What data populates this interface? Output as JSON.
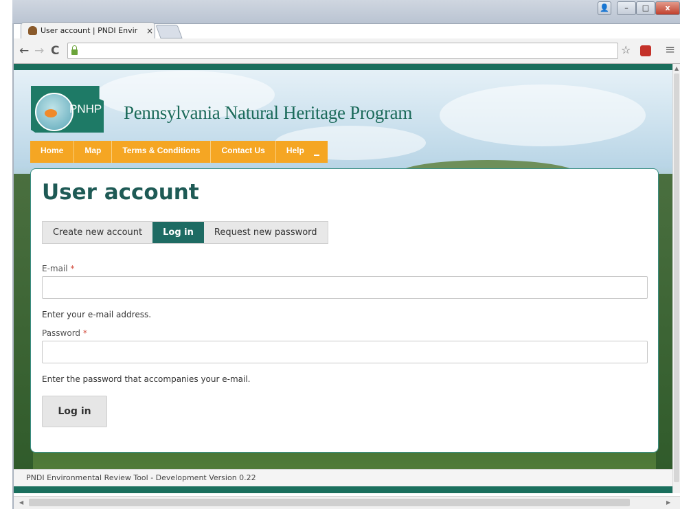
{
  "browser": {
    "tab_title": "User account | PNDI Envir",
    "tab_close": "×",
    "window_buttons": {
      "minimize": "–",
      "maximize": "□",
      "close": "x"
    }
  },
  "site": {
    "logo_text": "PNHP",
    "name": "Pennsylvania Natural Heritage Program",
    "nav": [
      {
        "label": "Home"
      },
      {
        "label": "Map"
      },
      {
        "label": "Terms & Conditions"
      },
      {
        "label": "Contact Us"
      },
      {
        "label": "Help"
      }
    ]
  },
  "page": {
    "title": "User account",
    "tabs": [
      {
        "label": "Create new account",
        "active": false
      },
      {
        "label": "Log in",
        "active": true
      },
      {
        "label": "Request new password",
        "active": false
      }
    ],
    "email": {
      "label": "E-mail",
      "required_marker": "*",
      "value": "",
      "description": "Enter your e-mail address."
    },
    "password": {
      "label": "Password",
      "required_marker": "*",
      "value": "",
      "description": "Enter the password that accompanies your e-mail."
    },
    "submit_label": "Log in"
  },
  "footer": {
    "text": "PNDI Environmental Review Tool - Development Version 0.22"
  },
  "colors": {
    "brand_teal": "#1e6b63",
    "nav_orange": "#f5a623",
    "required_red": "#d24b3c"
  }
}
